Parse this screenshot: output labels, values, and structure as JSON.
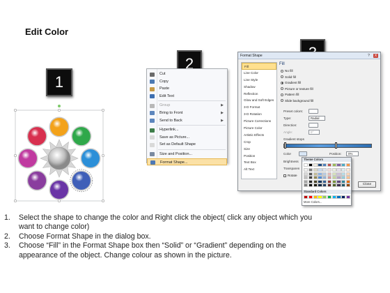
{
  "title": "Edit Color",
  "steps": [
    "1",
    "2",
    "3"
  ],
  "context_menu": {
    "items": [
      {
        "label": "Cut",
        "icon": "scissors-icon",
        "color": "#6b6b6b",
        "arrow": false,
        "disabled": false
      },
      {
        "label": "Copy",
        "icon": "copy-icon",
        "color": "#4c7ab3",
        "arrow": false,
        "disabled": false
      },
      {
        "label": "Paste",
        "icon": "paste-icon",
        "color": "#c69a45",
        "arrow": false,
        "disabled": false
      },
      {
        "label": "Edit Text",
        "icon": "edit-text-icon",
        "color": "#3e6fb0",
        "arrow": false,
        "disabled": false
      },
      {
        "label": "Group",
        "icon": "group-icon",
        "color": "#b8b8b8",
        "arrow": true,
        "disabled": true
      },
      {
        "label": "Bring to Front",
        "icon": "bring-to-front-icon",
        "color": "#5d86bd",
        "arrow": true,
        "disabled": false
      },
      {
        "label": "Send to Back",
        "icon": "send-to-back-icon",
        "color": "#5d86bd",
        "arrow": true,
        "disabled": false
      },
      {
        "label": "Hyperlink...",
        "icon": "hyperlink-icon",
        "color": "#3f7d4a",
        "arrow": false,
        "disabled": false
      },
      {
        "label": "Save as Picture...",
        "icon": "save-picture-icon",
        "color": "#d9d9d9",
        "arrow": false,
        "disabled": false
      },
      {
        "label": "Set as Default Shape",
        "icon": "default-shape-icon",
        "color": "#d9d9d9",
        "arrow": false,
        "disabled": false
      },
      {
        "label": "Size and Position...",
        "icon": "size-position-icon",
        "color": "#7a8aa0",
        "arrow": false,
        "disabled": false
      },
      {
        "label": "Format Shape...",
        "icon": "format-shape-icon",
        "color": "#4f79b4",
        "arrow": false,
        "disabled": false
      }
    ]
  },
  "format_dialog": {
    "title": "Format Shape",
    "help_button": "?",
    "close_x": "X",
    "nav": [
      "Fill",
      "Line Color",
      "Line Style",
      "Shadow",
      "Reflection",
      "Glow and Soft Edges",
      "3-D Format",
      "3-D Rotation",
      "Picture Corrections",
      "Picture Color",
      "Artistic Effects",
      "Crop",
      "Size",
      "Position",
      "Text Box",
      "Alt Text"
    ],
    "panel_heading": "Fill",
    "fill_options": [
      "No fill",
      "Solid fill",
      "Gradient fill",
      "Picture or texture fill",
      "Pattern fill",
      "Slide background fill"
    ],
    "selected_fill": "Gradient fill",
    "preset_colors_label": "Preset colors:",
    "type_label": "Type:",
    "type_value": "Radial",
    "direction_label": "Direction:",
    "angle_label": "Angle:",
    "angle_value": "0°",
    "gradient_stops_label": "Gradient stops",
    "color_label": "Color",
    "position_label": "Position:",
    "position_value": "0%",
    "brightness_label": "Brightness",
    "transparency_label": "Transparen",
    "rotate_label": "Rotate",
    "close_button": "Close"
  },
  "color_picker": {
    "theme_label": "Theme Colors",
    "standard_label": "Standard Colors",
    "more_label": "More Colors...",
    "theme_top": [
      "#ffffff",
      "#000000",
      "#eeece1",
      "#1f497d",
      "#4f81bd",
      "#c0504d",
      "#9bbb59",
      "#8064a2",
      "#4bacc6",
      "#f79646"
    ],
    "shade_columns": [
      [
        "#f2f2f2",
        "#d9d9d9",
        "#bfbfbf",
        "#a6a6a6",
        "#7f7f7f"
      ],
      [
        "#7f7f7f",
        "#595959",
        "#404040",
        "#262626",
        "#0d0d0d"
      ],
      [
        "#ddd9c3",
        "#c4bd97",
        "#938953",
        "#494429",
        "#1d1b10"
      ],
      [
        "#c6d9f0",
        "#8db3e2",
        "#548dd4",
        "#17365d",
        "#0f243e"
      ],
      [
        "#dbe5f1",
        "#b8cce4",
        "#95b3d7",
        "#366092",
        "#244061"
      ],
      [
        "#f2dcdb",
        "#e5b9b7",
        "#d99694",
        "#953734",
        "#632423"
      ],
      [
        "#ebf1dd",
        "#d7e3bc",
        "#c3d69b",
        "#76923c",
        "#4f6128"
      ],
      [
        "#e5e0ec",
        "#ccc1d9",
        "#b2a2c7",
        "#5f497a",
        "#3f3151"
      ],
      [
        "#dbeef3",
        "#b7dde8",
        "#92cddc",
        "#31859b",
        "#205867"
      ],
      [
        "#fdeada",
        "#fbd5b5",
        "#fac08f",
        "#e36c09",
        "#974806"
      ]
    ],
    "standard": [
      "#c00000",
      "#ff0000",
      "#ffc000",
      "#ffff00",
      "#92d050",
      "#00b050",
      "#00b0f0",
      "#0070c0",
      "#002060",
      "#7030a0"
    ]
  },
  "diagram": {
    "circle_colors": [
      "#f3a21a",
      "#2fa84a",
      "#2c8fd8",
      "#3f5fb8",
      "#6a35a6",
      "#8a3d9e",
      "#c03aa0",
      "#d8304f"
    ]
  },
  "instructions": [
    {
      "num": "1.",
      "lines": [
        "Select the shape to change the color and Right click the object( click any object which you",
        "want to change color)"
      ]
    },
    {
      "num": "2.",
      "lines": [
        "Choose Format Shape in the dialog box."
      ]
    },
    {
      "num": "3.",
      "lines": [
        "Choose “Fill” in the Format Shape box then “Solid” or “Gradient” depending on the",
        "appearance of the object. Change colour as shown in the picture."
      ]
    }
  ]
}
